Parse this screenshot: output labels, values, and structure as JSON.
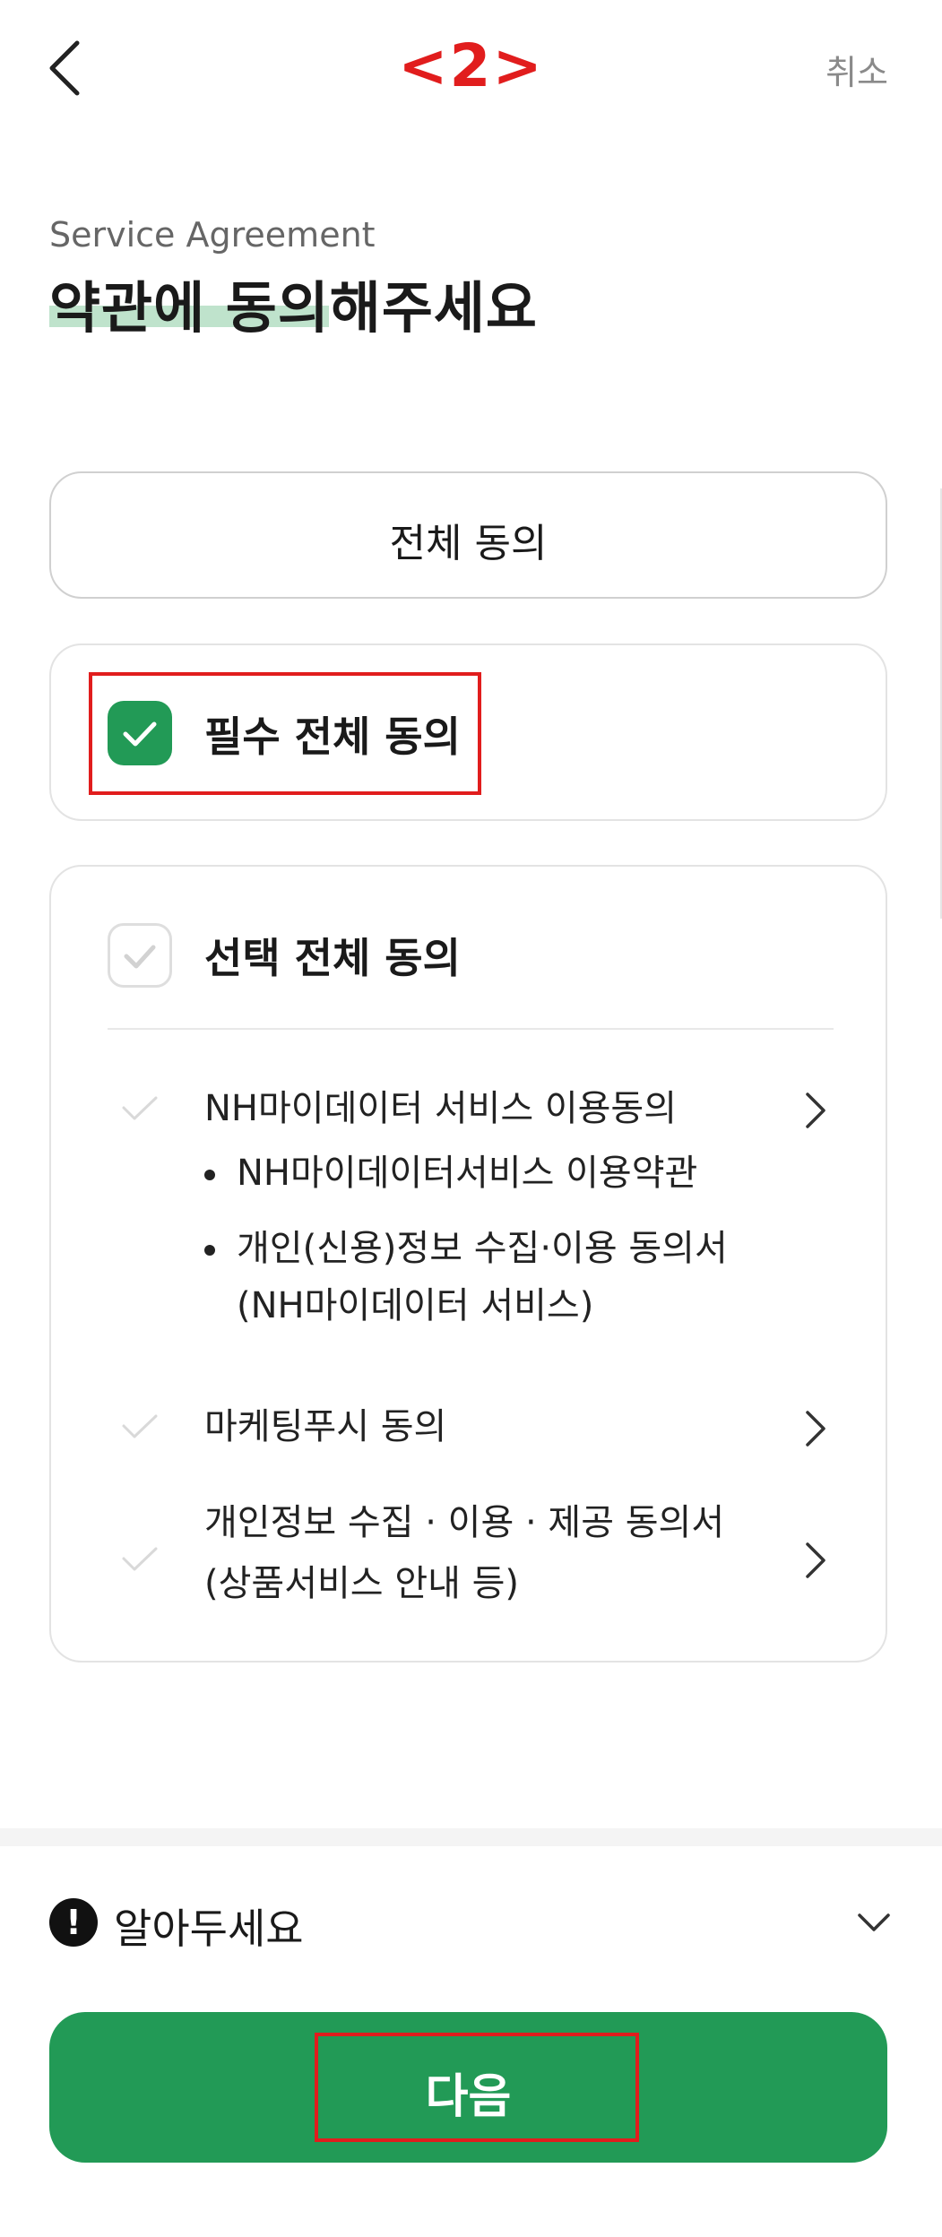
{
  "header": {
    "step_marker": "<2>",
    "cancel_label": "취소"
  },
  "intro": {
    "subtitle": "Service Agreement",
    "title": "약관에 동의해주세요"
  },
  "agreements": {
    "all_label": "전체 동의",
    "required_all_label": "필수 전체 동의",
    "required_all_checked": true,
    "optional_all_label": "선택 전체 동의",
    "optional_all_checked": false,
    "items": [
      {
        "label": "NH마이데이터 서비스 이용동의",
        "sub_items": [
          "NH마이데이터서비스 이용약관",
          "개인(신용)정보 수집·이용 동의서",
          "(NH마이데이터 서비스)"
        ]
      },
      {
        "label": "마케팅푸시 동의"
      },
      {
        "label_line1": "개인정보 수집 · 이용 · 제공 동의서",
        "label_line2": "(상품서비스 안내 등)"
      }
    ]
  },
  "notice": {
    "label": "알아두세요"
  },
  "footer": {
    "next_label": "다음"
  },
  "colors": {
    "brand_green": "#229a56",
    "highlight_green": "#bfe3cc",
    "annotation_red": "#e11d1d"
  },
  "icons": {
    "back": "chevron-left-icon",
    "check": "check-icon",
    "item_chevron": "chevron-right-icon",
    "notice": "exclamation-circle-icon",
    "expand": "chevron-down-icon"
  }
}
